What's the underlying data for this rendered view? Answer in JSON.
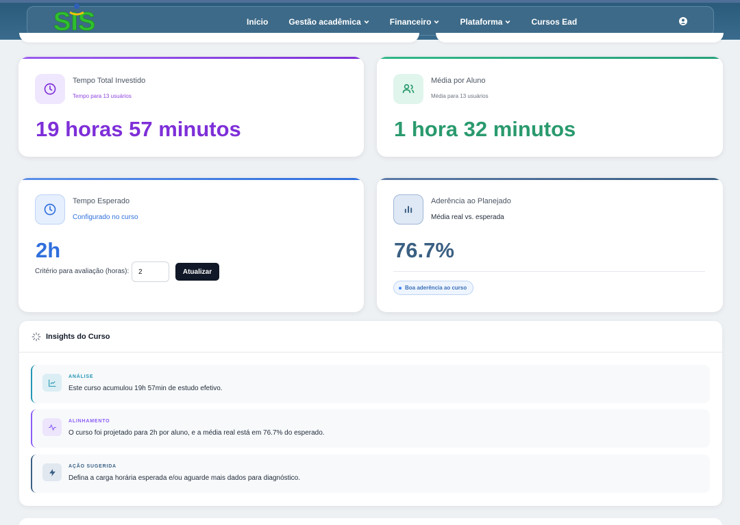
{
  "app": {
    "logo_text": "SIS",
    "colors": {
      "header": "#3d6a88",
      "purple": "#7e2fd8",
      "green": "#2a9a6e",
      "blue": "#2f6fdc",
      "slate": "#3a5f82"
    }
  },
  "nav": {
    "items": [
      {
        "label": "Início",
        "has_dropdown": false
      },
      {
        "label": "Gestão acadêmica",
        "has_dropdown": true
      },
      {
        "label": "Financeiro",
        "has_dropdown": true
      },
      {
        "label": "Plataforma",
        "has_dropdown": true
      },
      {
        "label": "Cursos Ead",
        "has_dropdown": false
      }
    ],
    "user_icon": "user-circle-icon"
  },
  "cards": {
    "total_time": {
      "title": "Tempo Total Investido",
      "subtitle": "Tempo para 13 usuários",
      "value": "19 horas 57 minutos",
      "icon": "clock-icon"
    },
    "per_student": {
      "title": "Média por Aluno",
      "subtitle": "Média para 13 usuários",
      "value": "1 hora 32 minutos",
      "icon": "users-icon"
    },
    "expected": {
      "title": "Tempo Esperado",
      "subtitle": "Configurado no curso",
      "value": "2h",
      "icon": "clock-icon",
      "criterion_label": "Critério para avaliação (horas):",
      "criterion_value": "2",
      "update_button": "Atualizar"
    },
    "adherence": {
      "title": "Aderência ao Planejado",
      "subtitle": "Média real vs. esperada",
      "value": "76.7%",
      "icon": "bar-chart-icon",
      "badge": "Boa aderência ao curso"
    }
  },
  "insights": {
    "title": "Insights do Curso",
    "items": [
      {
        "label": "ANÁLISE",
        "text": "Este curso acumulou 19h 57min de estudo efetivo.",
        "icon": "line-chart-icon",
        "color": "#2596b5"
      },
      {
        "label": "ALINHAMENTO",
        "text": "O curso foi projetado para 2h por aluno, e a média real está em 76.7% do esperado.",
        "icon": "activity-icon",
        "color": "#8b5cf6"
      },
      {
        "label": "AÇÃO SUGERIDA",
        "text": "Defina a carga horária esperada e/ou aguarde mais dados para diagnóstico.",
        "icon": "zap-icon",
        "color": "#3a5f82"
      }
    ]
  }
}
